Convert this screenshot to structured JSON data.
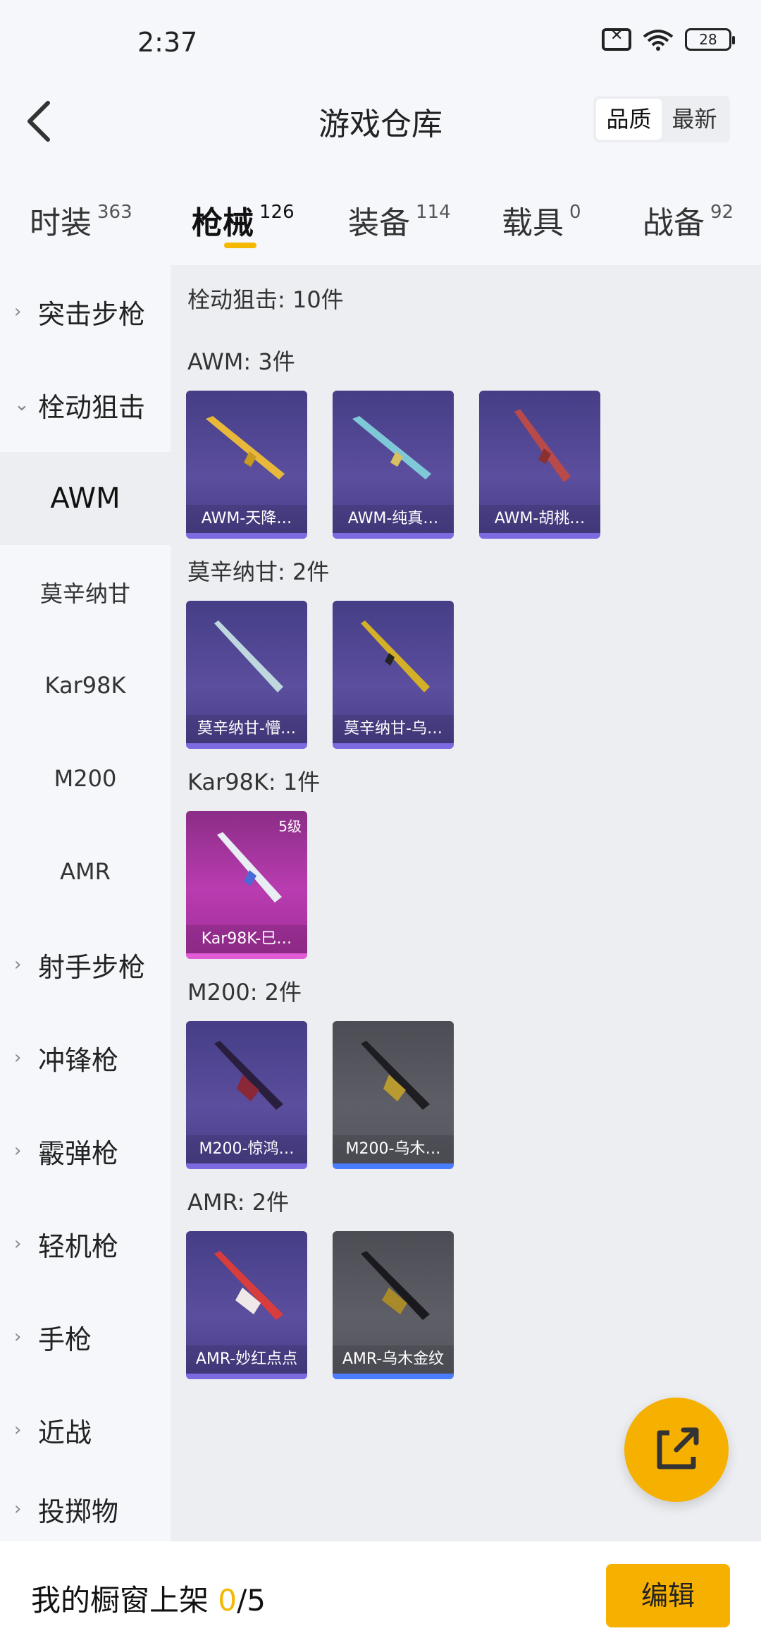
{
  "status_bar": {
    "time": "2:37",
    "battery": "28"
  },
  "header": {
    "title": "游戏仓库",
    "sort_options": [
      "品质",
      "最新"
    ]
  },
  "tabs": [
    {
      "label": "时装",
      "count": "363"
    },
    {
      "label": "枪械",
      "count": "126"
    },
    {
      "label": "装备",
      "count": "114"
    },
    {
      "label": "载具",
      "count": "0"
    },
    {
      "label": "战备",
      "count": "92"
    }
  ],
  "sidebar": {
    "items": [
      {
        "label": "突击步枪"
      },
      {
        "label": "栓动狙击"
      },
      {
        "label": "AWM"
      },
      {
        "label": "莫辛纳甘"
      },
      {
        "label": "Kar98K"
      },
      {
        "label": "M200"
      },
      {
        "label": "AMR"
      },
      {
        "label": "射手步枪"
      },
      {
        "label": "冲锋枪"
      },
      {
        "label": "霰弹枪"
      },
      {
        "label": "轻机枪"
      },
      {
        "label": "手枪"
      },
      {
        "label": "近战"
      },
      {
        "label": "投掷物"
      }
    ]
  },
  "content": {
    "category_total": "栓动狙击: 10件",
    "groups": [
      {
        "heading": "AWM: 3件",
        "items": [
          {
            "name": "AWM-天降…",
            "rarity": "purple"
          },
          {
            "name": "AWM-纯真…",
            "rarity": "purple"
          },
          {
            "name": "AWM-胡桃…",
            "rarity": "purple"
          }
        ]
      },
      {
        "heading": "莫辛纳甘: 2件",
        "items": [
          {
            "name": "莫辛纳甘-懵…",
            "rarity": "purple"
          },
          {
            "name": "莫辛纳甘-乌…",
            "rarity": "purple"
          }
        ]
      },
      {
        "heading": "Kar98K: 1件",
        "items": [
          {
            "name": "Kar98K-巳…",
            "rarity": "pink",
            "level": "5级"
          }
        ]
      },
      {
        "heading": "M200: 2件",
        "items": [
          {
            "name": "M200-惊鸿…",
            "rarity": "purple"
          },
          {
            "name": "M200-乌木…",
            "rarity": "gray"
          }
        ]
      },
      {
        "heading": "AMR: 2件",
        "items": [
          {
            "name": "AMR-妙红点点",
            "rarity": "purple"
          },
          {
            "name": "AMR-乌木金纹",
            "rarity": "gray"
          }
        ]
      }
    ]
  },
  "bottom_bar": {
    "label": "我的橱窗上架 ",
    "current": "0",
    "total": "/5",
    "edit_label": "编辑"
  },
  "colors": {
    "accent": "#f6b000",
    "purple_rarity": "#5b4e9e",
    "pink_rarity": "#b93cb0",
    "gray_rarity": "#5d5e66"
  }
}
